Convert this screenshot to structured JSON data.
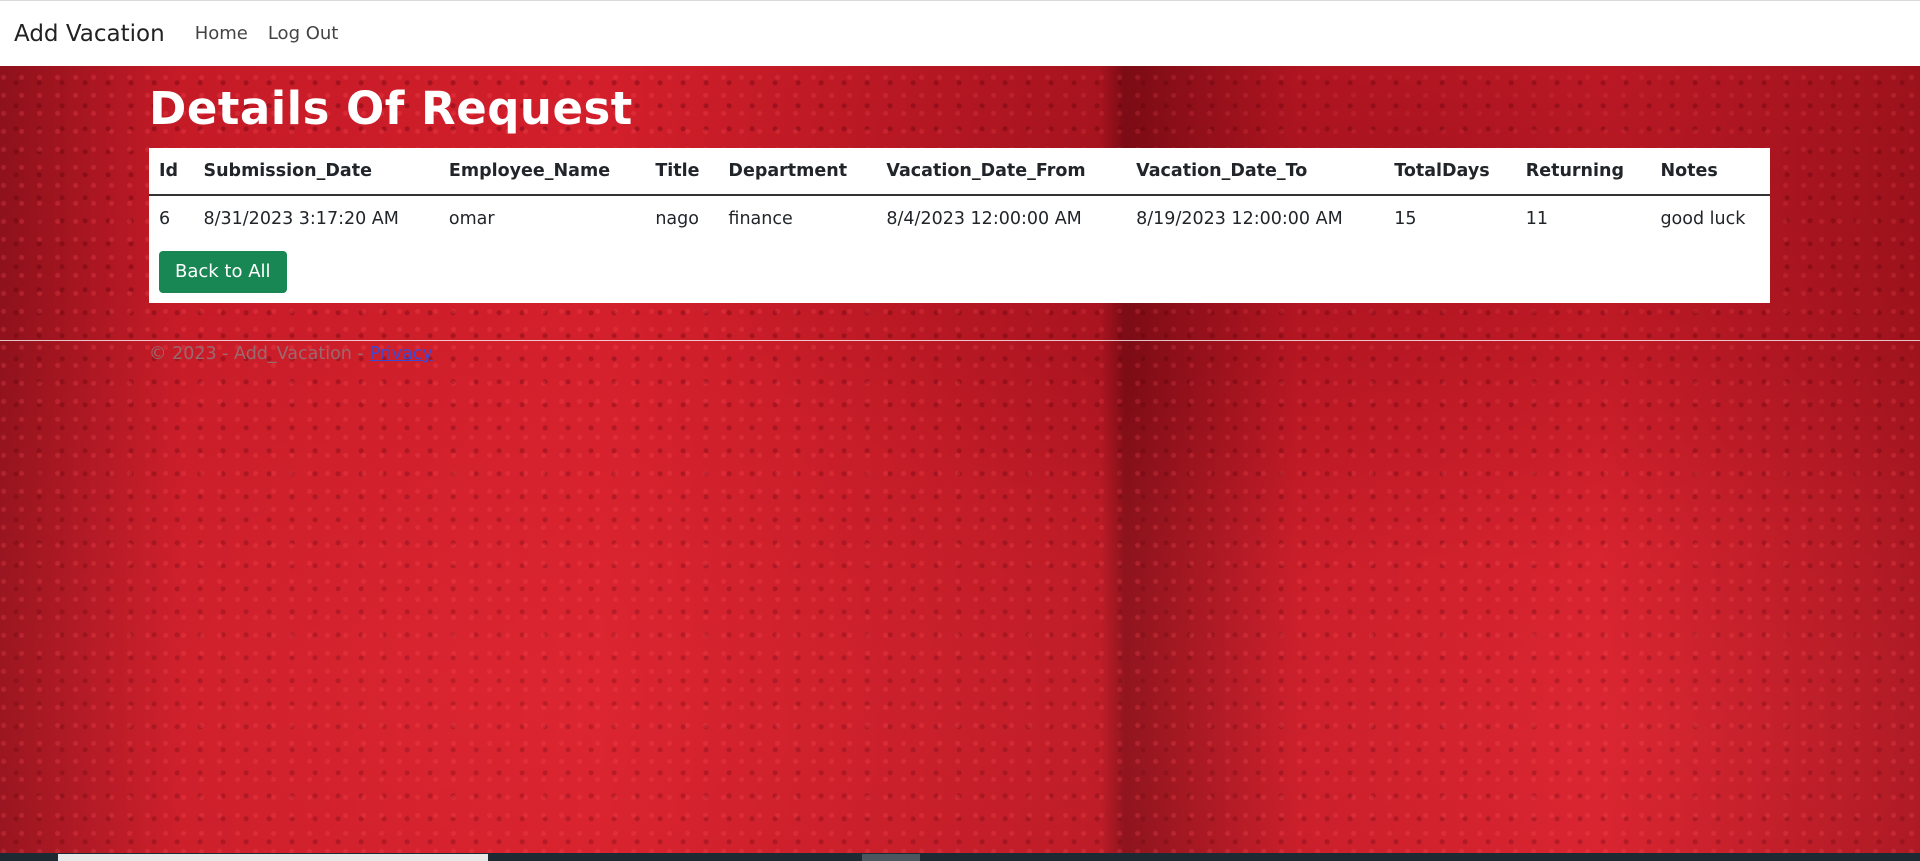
{
  "navbar": {
    "brand": "Add Vacation",
    "links": [
      "Home",
      "Log Out"
    ]
  },
  "page": {
    "title": "Details Of Request"
  },
  "table": {
    "headers": [
      "Id",
      "Submission_Date",
      "Employee_Name",
      "Title",
      "Department",
      "Vacation_Date_From",
      "Vacation_Date_To",
      "TotalDays",
      "Returning",
      "Notes"
    ],
    "rows": [
      [
        "6",
        "8/31/2023 3:17:20 AM",
        "omar",
        "nago",
        "finance",
        "8/4/2023 12:00:00 AM",
        "8/19/2023 12:00:00 AM",
        "15",
        "11",
        "good luck"
      ]
    ]
  },
  "actions": {
    "back_label": "Back to All"
  },
  "footer": {
    "text": "© 2023 - Add_Vacation - ",
    "privacy_label": "Privacy"
  },
  "colors": {
    "background": "#c41a26",
    "button": "#198754",
    "link": "#3b4bd6"
  }
}
